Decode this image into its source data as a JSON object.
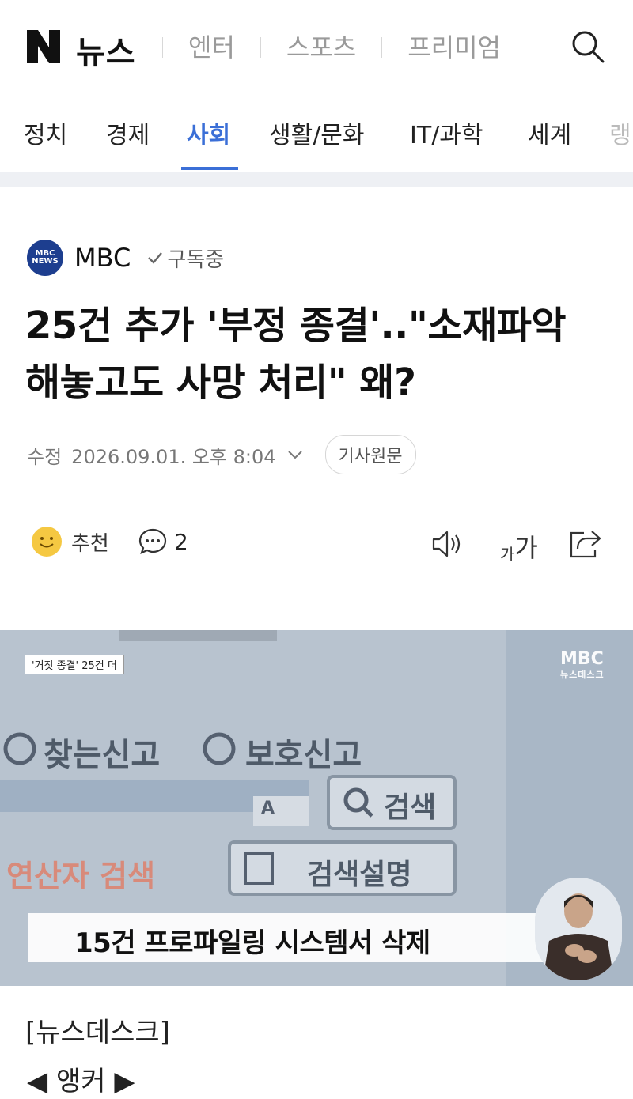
{
  "header": {
    "logo_letter": "N",
    "title": "뉴스",
    "nav": [
      "엔터",
      "스포츠",
      "프리미엄"
    ],
    "search_icon": "search-icon"
  },
  "categories": {
    "items": [
      "정치",
      "경제",
      "사회",
      "생활/문화",
      "IT/과학",
      "세계",
      "랭"
    ],
    "active": "사회",
    "active_color": "#3b6fd7"
  },
  "article": {
    "press_name": "MBC",
    "press_logo_text": "MBC NEWS",
    "subscribe_label": "구독중",
    "headline": "25건 추가 '부정 종결'..\"소재파악 해놓고도 사망 처리\" 왜?",
    "modified_label": "수정",
    "datetime": "2026.09.01. 오후 8:04",
    "original_button": "기사원문",
    "recommend_label": "추천",
    "comment_count": "2",
    "font_size_label_small": "가",
    "font_size_label_large": "가"
  },
  "image": {
    "corner_tag": "'거짓 종결' 25건 더",
    "watermark": "MBC",
    "watermark_sub": "뉴스데스크",
    "screen_text_1": "찾는신고",
    "screen_text_2": "보호신고",
    "screen_button_search": "검색",
    "screen_label_name": "연산자 검색",
    "screen_button_help": "검색설명",
    "screen_dropdown": "A",
    "caption": "15건 프로파일링 시스템서 삭제"
  },
  "body": {
    "program": "[뉴스데스크]",
    "anchor": "◀ 앵커 ▶"
  }
}
